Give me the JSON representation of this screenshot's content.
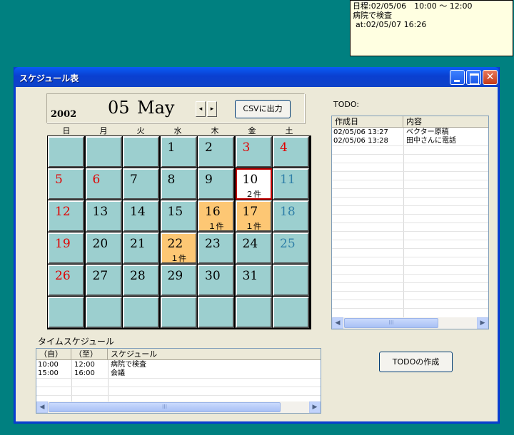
{
  "note": {
    "line1": "日程:02/05/06　10:00 ～ 12:00",
    "line2": "病院で検査",
    "line3": "at:02/05/07 16:26"
  },
  "window": {
    "title": "スケジュール表",
    "close_glyph": "✕"
  },
  "calendar": {
    "year": "2002",
    "month_number": "05",
    "month_name": "May",
    "prev_glyph": "◂",
    "next_glyph": "▸",
    "csv_button": "CSVに出力",
    "weekdays": [
      "日",
      "月",
      "火",
      "水",
      "木",
      "金",
      "土"
    ],
    "rows": [
      [
        {
          "d": "",
          "c": ""
        },
        {
          "d": "",
          "c": ""
        },
        {
          "d": "",
          "c": ""
        },
        {
          "d": "1",
          "c": ""
        },
        {
          "d": "2",
          "c": ""
        },
        {
          "d": "3",
          "c": ""
        },
        {
          "d": "4",
          "c": ""
        }
      ],
      [
        {
          "d": "5",
          "c": ""
        },
        {
          "d": "6",
          "c": ""
        },
        {
          "d": "7",
          "c": ""
        },
        {
          "d": "8",
          "c": ""
        },
        {
          "d": "9",
          "c": ""
        },
        {
          "d": "10",
          "c": "２件"
        },
        {
          "d": "11",
          "c": ""
        }
      ],
      [
        {
          "d": "12",
          "c": ""
        },
        {
          "d": "13",
          "c": ""
        },
        {
          "d": "14",
          "c": ""
        },
        {
          "d": "15",
          "c": ""
        },
        {
          "d": "16",
          "c": "１件"
        },
        {
          "d": "17",
          "c": "１件"
        },
        {
          "d": "18",
          "c": ""
        }
      ],
      [
        {
          "d": "19",
          "c": ""
        },
        {
          "d": "20",
          "c": ""
        },
        {
          "d": "21",
          "c": ""
        },
        {
          "d": "22",
          "c": "１件"
        },
        {
          "d": "23",
          "c": ""
        },
        {
          "d": "24",
          "c": ""
        },
        {
          "d": "25",
          "c": ""
        }
      ],
      [
        {
          "d": "26",
          "c": ""
        },
        {
          "d": "27",
          "c": ""
        },
        {
          "d": "28",
          "c": ""
        },
        {
          "d": "29",
          "c": ""
        },
        {
          "d": "30",
          "c": ""
        },
        {
          "d": "31",
          "c": ""
        },
        {
          "d": "",
          "c": ""
        }
      ],
      [
        {
          "d": "",
          "c": ""
        },
        {
          "d": "",
          "c": ""
        },
        {
          "d": "",
          "c": ""
        },
        {
          "d": "",
          "c": ""
        },
        {
          "d": "",
          "c": ""
        },
        {
          "d": "",
          "c": ""
        },
        {
          "d": "",
          "c": ""
        }
      ]
    ],
    "holiday_red_days": [
      "3",
      "4",
      "5",
      "6"
    ],
    "today": "10",
    "colors": {
      "cell": "#9ccfcf",
      "event_cell": "#fdc774",
      "today_border": "#c00000",
      "sunday_holiday": "#e00000",
      "saturday": "#2f7fa8"
    }
  },
  "time_schedule": {
    "label": "タイムスケジュール",
    "columns": [
      "（自）",
      "（至）",
      "スケジュール"
    ],
    "rows": [
      {
        "from": "10:00",
        "to": "12:00",
        "text": "病院で検査"
      },
      {
        "from": "15:00",
        "to": "16:00",
        "text": "会議"
      }
    ],
    "scroll_thumb_grip": "III"
  },
  "todo": {
    "label": "TODO:",
    "columns": [
      "作成日",
      "内容"
    ],
    "rows": [
      {
        "date": "02/05/06 13:27",
        "text": "ベクター原稿"
      },
      {
        "date": "02/05/06 13:28",
        "text": "田中さんに電話"
      }
    ],
    "create_button": "TODOの作成",
    "scroll_thumb_grip": "III"
  },
  "scroll_glyphs": {
    "left": "◀",
    "right": "▶"
  }
}
